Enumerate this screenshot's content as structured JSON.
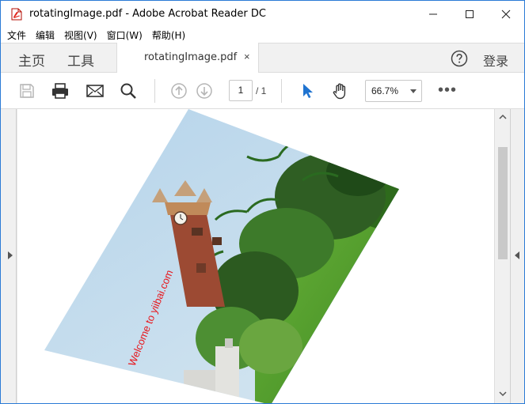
{
  "window": {
    "title": "rotatingImage.pdf - Adobe Acrobat Reader DC"
  },
  "menu": [
    "文件",
    "编辑",
    "视图(V)",
    "窗口(W)",
    "帮助(H)"
  ],
  "tabs": {
    "home": "主页",
    "tools": "工具",
    "document": "rotatingImage.pdf",
    "close": "×",
    "signin": "登录"
  },
  "toolbar": {
    "page_current": "1",
    "page_total": "/ 1",
    "zoom": "66.7%",
    "more": "•••"
  },
  "document": {
    "watermark_text": "Welcome to yiibai.com"
  },
  "colors": {
    "accent": "#2b7bd6",
    "pointer_tool": "#1f73d0",
    "watermark": "#e8161c"
  }
}
